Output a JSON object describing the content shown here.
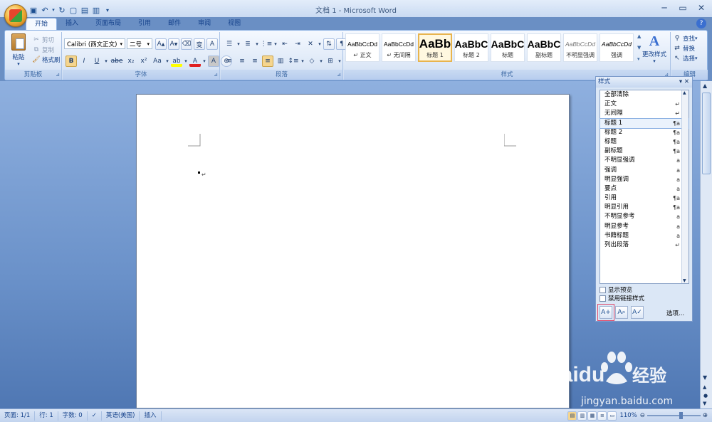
{
  "window": {
    "title": "文档 1 - Microsoft Word"
  },
  "quick_access": {
    "icons": [
      "save-icon",
      "undo-icon",
      "redo-icon",
      "new-doc-icon",
      "print-preview-icon",
      "open-icon"
    ]
  },
  "tabs": [
    "开始",
    "插入",
    "页面布局",
    "引用",
    "邮件",
    "审阅",
    "视图"
  ],
  "ribbon": {
    "clipboard": {
      "label": "剪贴板",
      "paste": "粘贴",
      "cut": "剪切",
      "copy": "复制",
      "format_painter": "格式刷"
    },
    "font": {
      "label": "字体",
      "font_name": "Calibri (西文正文)",
      "font_size": "二号",
      "bold": "B",
      "italic": "I",
      "underline": "U",
      "strike": "abe",
      "subscript": "x₂",
      "superscript": "x²",
      "change_case": "Aa",
      "grow": "A",
      "shrink": "A"
    },
    "paragraph": {
      "label": "段落"
    },
    "styles": {
      "label": "样式",
      "items": [
        {
          "preview": "AaBbCcDd",
          "name": "↵ 正文"
        },
        {
          "preview": "AaBbCcDd",
          "name": "↵ 无间隔"
        },
        {
          "preview": "AaBb",
          "name": "标题 1"
        },
        {
          "preview": "AaBbC",
          "name": "标题 2"
        },
        {
          "preview": "AaBbC",
          "name": "标题"
        },
        {
          "preview": "AaBbC",
          "name": "副标题"
        },
        {
          "preview": "AaBbCcDd",
          "name": "不明显强调"
        },
        {
          "preview": "AaBbCcDd",
          "name": "强调"
        }
      ],
      "change_styles": "更改样式"
    },
    "editing": {
      "label": "编辑",
      "find": "查找",
      "replace": "替换",
      "select": "选择"
    }
  },
  "styles_pane": {
    "title": "样式",
    "items": [
      {
        "name": "全部清除",
        "mark": ""
      },
      {
        "name": "正文",
        "mark": "↵"
      },
      {
        "name": "无间隔",
        "mark": "↵"
      },
      {
        "name": "标题 1",
        "mark": "¶a"
      },
      {
        "name": "标题 2",
        "mark": "¶a"
      },
      {
        "name": "标题",
        "mark": "¶a"
      },
      {
        "name": "副标题",
        "mark": "¶a"
      },
      {
        "name": "不明显强调",
        "mark": "a"
      },
      {
        "name": "强调",
        "mark": "a"
      },
      {
        "name": "明显强调",
        "mark": "a"
      },
      {
        "name": "要点",
        "mark": "a"
      },
      {
        "name": "引用",
        "mark": "¶a"
      },
      {
        "name": "明显引用",
        "mark": "¶a"
      },
      {
        "name": "不明显参考",
        "mark": "a"
      },
      {
        "name": "明显参考",
        "mark": "a"
      },
      {
        "name": "书籍标题",
        "mark": "a"
      },
      {
        "name": "列出段落",
        "mark": "↵"
      }
    ],
    "show_preview": "显示预览",
    "disable_linked": "禁用链接样式",
    "options": "选项..."
  },
  "document": {
    "paragraph_mark": "↵"
  },
  "status": {
    "page": "页面: 1/1",
    "line": "行: 1",
    "words": "字数: 0",
    "language": "英语(美国)",
    "mode": "插入",
    "zoom": "110%"
  },
  "watermark": {
    "brand": "Baidu",
    "brand_cn": "经验",
    "url": "jingyan.baidu.com"
  }
}
